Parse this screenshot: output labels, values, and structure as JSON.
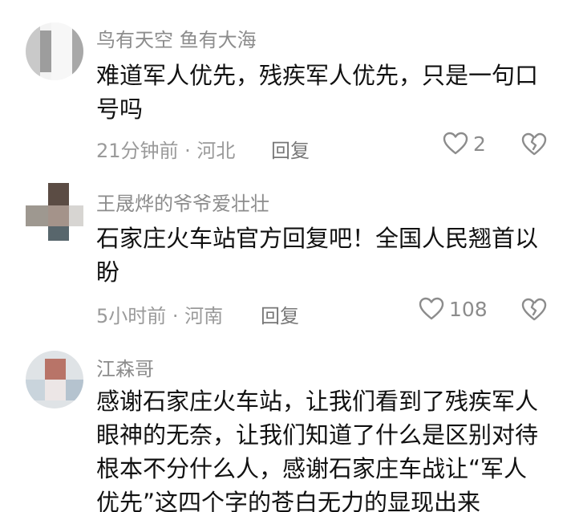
{
  "comments": [
    {
      "username": "鸟有天空  鱼有大海",
      "text": "难道军人优先，残疾军人优先，只是一句口号吗",
      "meta": "21分钟前 · 河北",
      "reply_label": "回复",
      "likes": "2"
    },
    {
      "username": "王晟烨的爷爷爱壮壮",
      "text": "石家庄火车站官方回复吧！全国人民翘首以盼",
      "meta": "5小时前 · 河南",
      "reply_label": "回复",
      "likes": "108"
    },
    {
      "username": "江森哥",
      "text": "感谢石家庄火车站，让我们看到了残疾军人眼神的无奈，让我们知道了什么是区别对待根本不分什么人，感谢石家庄车战让“军人优先”这四个字的苍白无力的显现出来"
    }
  ],
  "icons": {
    "like": "heart-outline-icon",
    "dislike": "broken-heart-icon"
  },
  "colors": {
    "text": "#111111",
    "secondary": "#8c8c8c"
  }
}
